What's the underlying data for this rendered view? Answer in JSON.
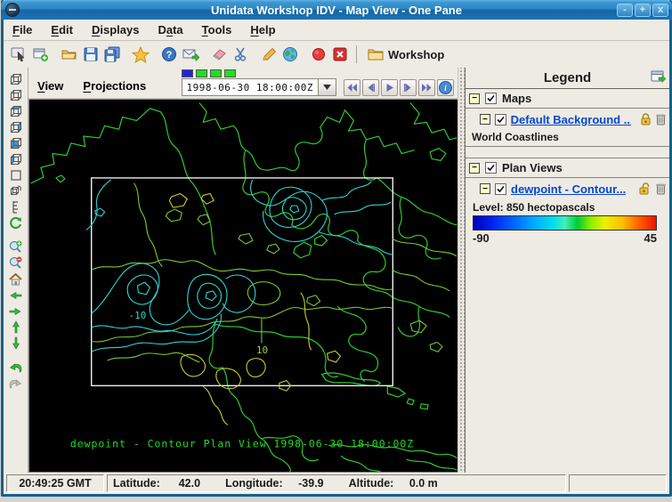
{
  "window": {
    "title": "Unidata Workshop IDV - Map View - One Pane",
    "controls": {
      "minimize": "-",
      "maximize": "+",
      "close": "x"
    }
  },
  "menus": [
    {
      "label": "File",
      "mnemonic": "F"
    },
    {
      "label": "Edit",
      "mnemonic": "E"
    },
    {
      "label": "Displays",
      "mnemonic": "D"
    },
    {
      "label": "Data",
      "mnemonic": "a"
    },
    {
      "label": "Tools",
      "mnemonic": "T"
    },
    {
      "label": "Help",
      "mnemonic": "H"
    }
  ],
  "toolbar": {
    "icons": [
      "show-dashboard",
      "new-window",
      "open-folder",
      "save",
      "save-as",
      "favorites-star",
      "help",
      "support-mail",
      "eraser",
      "scissors",
      "pencil",
      "globe",
      "record",
      "exit"
    ],
    "workshop_label": "Workshop"
  },
  "sidebar_icons": [
    "cube-wire-1",
    "cube-wire-2",
    "cube-top-face",
    "cube-right-face",
    "cube-front-face",
    "cube-left-face",
    "flat-square",
    "rotate-cube",
    "vertical-scale",
    "auto-rotate",
    "zoom-in",
    "zoom-out",
    "home",
    "pan-left",
    "pan-right",
    "pan-up",
    "pan-down",
    "undo",
    "redo"
  ],
  "map_view": {
    "menus": [
      {
        "label": "View",
        "mnemonic": "V"
      },
      {
        "label": "Projections",
        "mnemonic": "P"
      }
    ],
    "time": {
      "value": "1998-06-30 18:00:00Z",
      "steps": [
        "current",
        "loaded",
        "loaded",
        "loaded"
      ],
      "playback_icons": [
        "go-start",
        "step-back",
        "play",
        "step-forward",
        "go-end",
        "info"
      ]
    },
    "caption": "dewpoint - Contour Plan View 1998-06-30 18:00:00Z",
    "contour_labels": {
      "negative": "-10",
      "positive": "10"
    }
  },
  "legend": {
    "title": "Legend",
    "float_icon": "float-legend",
    "groups": [
      {
        "label": "Maps",
        "item_link": "Default Background ...",
        "item_sub": "World Coastlines",
        "lock_state": "locked"
      },
      {
        "label": "Plan Views",
        "item_link": "dewpoint - Contour...",
        "lock_state": "unlocked",
        "level_label": "Level: 850 hectopascals",
        "colorbar_min": "-90",
        "colorbar_max": "45"
      }
    ]
  },
  "status_bar": {
    "clock": "20:49:25 GMT",
    "latitude_label": "Latitude:",
    "latitude_value": "42.0",
    "longitude_label": "Longitude:",
    "longitude_value": "-39.9",
    "altitude_label": "Altitude:",
    "altitude_value": "0.0 m"
  },
  "colors": {
    "titlebar_top": "#3d97d2",
    "titlebar_bottom": "#1565a4",
    "panel_bg": "#eeebe4",
    "map_bg": "#000000",
    "coastline_green": "#2ecc2e",
    "contour_green": "#77cc33",
    "contour_cyan": "#2fd4d4",
    "contour_yellow": "#cccc33",
    "caption_green": "#22dd22",
    "link_blue": "#0646d6",
    "step_current": "#2222dd",
    "step_loaded": "#22dd22"
  }
}
